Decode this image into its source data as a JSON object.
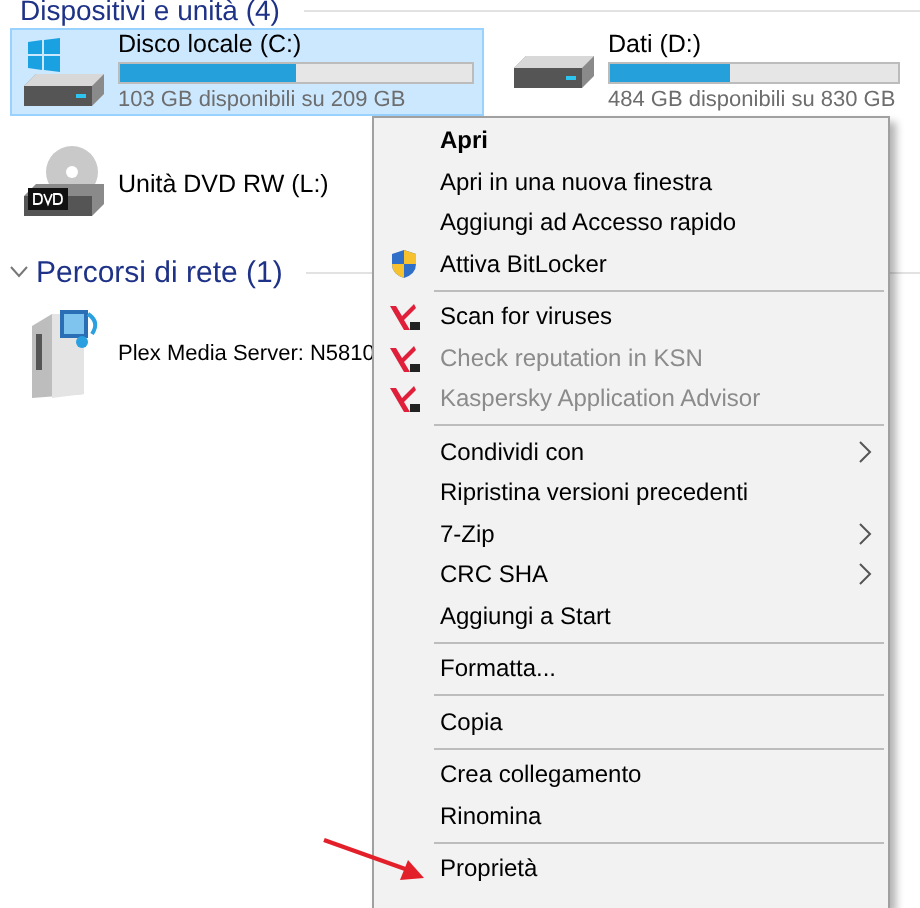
{
  "devices_section": {
    "title": "Dispositivi e unità (4)"
  },
  "drives": [
    {
      "kind": "system-disk",
      "name": "Disco locale (C:)",
      "level": 0.5,
      "free": "103 GB disponibili su 209 GB",
      "selected": true
    },
    {
      "kind": "disk",
      "name": "Dati (D:)",
      "level": 0.42,
      "free": "484 GB disponibili su 830 GB",
      "selected": false
    },
    {
      "kind": "dvd",
      "name": "Unità DVD RW (L:)",
      "selected": false
    }
  ],
  "network_section": {
    "title": "Percorsi di rete (1)",
    "expanded": true
  },
  "network_items": [
    {
      "name": "Plex Media Server: N5810"
    }
  ],
  "context_menu": [
    {
      "kind": "plain",
      "label": "Apri",
      "default": true,
      "disabled": false,
      "submenu": false
    },
    {
      "kind": "plain",
      "label": "Apri in una nuova finestra",
      "default": false,
      "disabled": false,
      "submenu": false
    },
    {
      "kind": "plain",
      "label": "Aggiungi ad Accesso rapido",
      "default": false,
      "disabled": false,
      "submenu": false
    },
    {
      "kind": "shield",
      "label": "Attiva BitLocker",
      "default": false,
      "disabled": false,
      "submenu": false
    },
    {
      "kind": "separator"
    },
    {
      "kind": "kaspersky",
      "label": "Scan for viruses",
      "default": false,
      "disabled": false,
      "submenu": false
    },
    {
      "kind": "kaspersky",
      "label": "Check reputation in KSN",
      "default": false,
      "disabled": true,
      "submenu": false
    },
    {
      "kind": "kaspersky",
      "label": "Kaspersky Application Advisor",
      "default": false,
      "disabled": true,
      "submenu": false
    },
    {
      "kind": "separator"
    },
    {
      "kind": "plain",
      "label": "Condividi con",
      "default": false,
      "disabled": false,
      "submenu": true
    },
    {
      "kind": "plain",
      "label": "Ripristina versioni precedenti",
      "default": false,
      "disabled": false,
      "submenu": false
    },
    {
      "kind": "plain",
      "label": "7-Zip",
      "default": false,
      "disabled": false,
      "submenu": true
    },
    {
      "kind": "plain",
      "label": "CRC SHA",
      "default": false,
      "disabled": false,
      "submenu": true
    },
    {
      "kind": "plain",
      "label": "Aggiungi a Start",
      "default": false,
      "disabled": false,
      "submenu": false
    },
    {
      "kind": "separator"
    },
    {
      "kind": "plain",
      "label": "Formatta...",
      "default": false,
      "disabled": false,
      "submenu": false
    },
    {
      "kind": "separator"
    },
    {
      "kind": "plain",
      "label": "Copia",
      "default": false,
      "disabled": false,
      "submenu": false
    },
    {
      "kind": "separator"
    },
    {
      "kind": "plain",
      "label": "Crea collegamento",
      "default": false,
      "disabled": false,
      "submenu": false
    },
    {
      "kind": "plain",
      "label": "Rinomina",
      "default": false,
      "disabled": false,
      "submenu": false
    },
    {
      "kind": "separator"
    },
    {
      "kind": "plain",
      "label": "Proprietà",
      "default": false,
      "disabled": false,
      "submenu": false
    }
  ]
}
